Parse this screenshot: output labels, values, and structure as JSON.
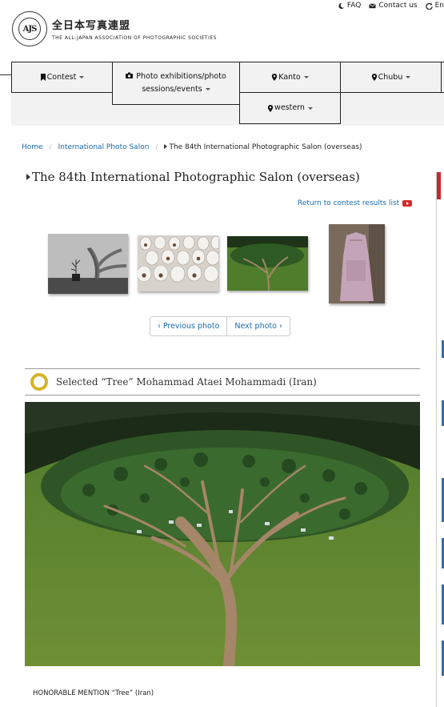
{
  "utility": {
    "faq": "FAQ",
    "contact": "Contact us",
    "english": "En"
  },
  "logo": {
    "mark": "AJS",
    "jp": "全日本写真連盟",
    "en": "THE ALL-JAPAN ASSOCIATION OF PHOTOGRAPHIC SOCIETIES"
  },
  "nav": {
    "contest": "Contest",
    "exhibitions_1": "Photo exhibitions/photo",
    "exhibitions_2": "sessions/events",
    "kanto": "Kanto",
    "chubu": "Chubu",
    "western": "western"
  },
  "breadcrumb": {
    "home": "Home",
    "salon": "International Photo Salon",
    "current": "The 84th International Photographic Salon (overseas)"
  },
  "page_title": "The 84th International Photographic Salon (overseas)",
  "return_link": "Return to contest results list",
  "pager": {
    "prev": "‹ Previous photo",
    "next": "Next photo ›"
  },
  "photo": {
    "heading": "Selected “Tree” Mohammad Ataei Mohammadi (Iran)",
    "caption": "HONORABLE MENTION “Tree” (Iran)"
  },
  "colors": {
    "link": "#1a6aa8",
    "accent_red": "#c8282c",
    "ring_gold": "#d4b32a"
  },
  "icons": [
    "moon-icon",
    "mail-icon",
    "refresh-icon",
    "bookmark-icon",
    "camera-icon",
    "location-pin-icon",
    "youtube-icon"
  ]
}
